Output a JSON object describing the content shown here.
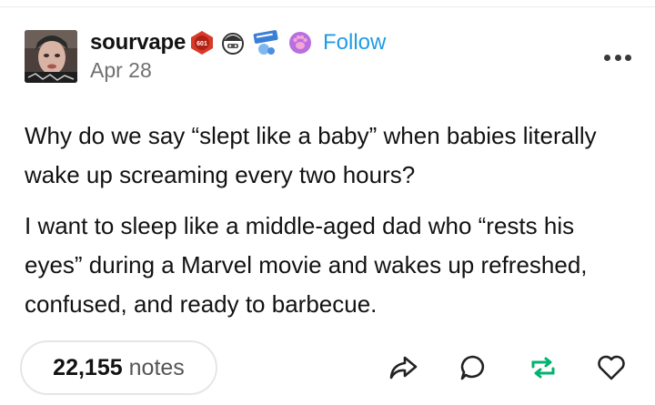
{
  "post": {
    "username": "sourvape",
    "follow_label": "Follow",
    "date": "Apr 28",
    "badge_text": "601",
    "paragraphs": [
      "Why do we say “slept like a baby” when babies literally wake up screaming every two hours?",
      "I want to sleep like a middle-aged dad who “rests his eyes” during a Marvel movie and wakes up refreshed, confused, and ready to barbecue."
    ]
  },
  "footer": {
    "notes_count": "22,155",
    "notes_label": "notes"
  },
  "colors": {
    "follow": "#1f9ce6",
    "reblog": "#00b371",
    "text": "#121212",
    "muted": "#707070"
  },
  "icons": [
    "more-options-icon",
    "share-icon",
    "reply-icon",
    "reblog-icon",
    "like-icon"
  ]
}
